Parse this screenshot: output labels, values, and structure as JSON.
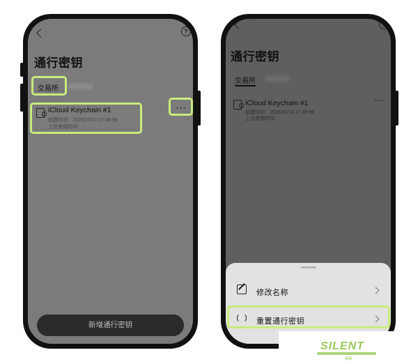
{
  "left_screen": {
    "title": "通行密钥",
    "tab_active": "交易所",
    "key": {
      "name": "iCloud Keychain #1",
      "created": "创建时间：2025/02/13 17:49:58",
      "last_used": "上次使用时间：-"
    },
    "more": "···",
    "add_button": "新增通行密钥"
  },
  "right_screen": {
    "title": "通行密钥",
    "tab_active": "交易所",
    "key": {
      "name": "iCloud Keychain #1",
      "created": "创建时间：2025/02/13 17:49:58",
      "last_used": "上次使用时间：-"
    },
    "more": "···",
    "sheet": {
      "rename": "修改名称",
      "reset": "重置通行密钥"
    }
  },
  "watermark": {
    "text": "SILENT",
    "sub": "赛蘭"
  },
  "colors": {
    "highlight": "#c7ec7b",
    "watermark": "#9cc85a"
  }
}
